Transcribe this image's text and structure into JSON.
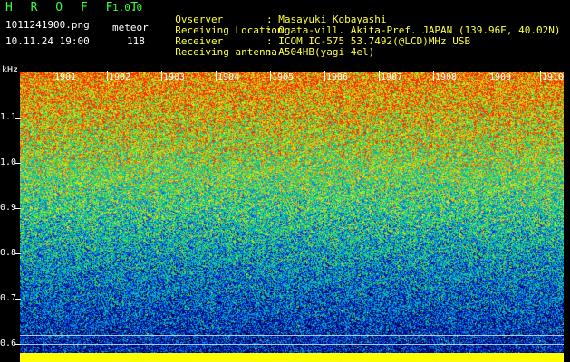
{
  "header": {
    "app_title": "H R O F F T",
    "version": "1.0.0",
    "filename": "1011241900.png",
    "datetime": "10.11.24 19:00",
    "meteor_label": "meteor",
    "meteor_count": "118"
  },
  "info": [
    {
      "key": "Ovserver",
      "value": "Masayuki Kobayashi"
    },
    {
      "key": "Receiving Location",
      "value": "Ogata-vill. Akita-Pref. JAPAN (139.96E, 40.02N)"
    },
    {
      "key": "Receiver",
      "value": "ICOM IC-575 53.7492(@LCD)MHz USB"
    },
    {
      "key": "Receiving antenna",
      "value": "A504HB(yagi 4el)"
    }
  ],
  "separator": ":",
  "axes": {
    "y_unit": "kHz",
    "y_ticks": [
      "1.1",
      "1.0",
      "0.9",
      "0.8",
      "0.7",
      "0.6"
    ],
    "x_ticks": [
      "1901",
      "1902",
      "1903",
      "1904",
      "1905",
      "1906",
      "1907",
      "1908",
      "1909",
      "1910"
    ]
  },
  "colors": {
    "header_green": "#36ff3a",
    "header_yellow": "#ffff3a",
    "baseline": "#ffff00"
  }
}
